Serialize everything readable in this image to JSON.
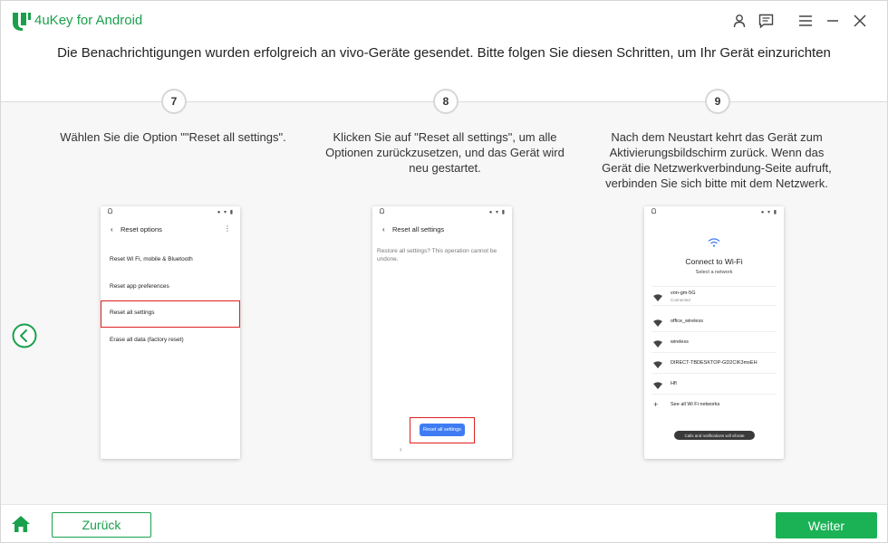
{
  "app": {
    "title": "4uKey for Android"
  },
  "heading": "Die Benachrichtigungen wurden erfolgreich an vivo-Geräte gesendet. Bitte folgen Sie diesen Schritten, um Ihr Gerät einzurichten",
  "steps": [
    {
      "number": "7",
      "description": "Wählen Sie die Option \"\"Reset all settings\".",
      "phone": {
        "title": "Reset options",
        "items": [
          "Reset Wi Fi, mobile & Bluetooth",
          "Reset app preferences",
          "Reset all settings",
          "Erase all data (factory reset)"
        ]
      }
    },
    {
      "number": "8",
      "description": "Klicken Sie auf \"Reset all settings\", um alle Optionen zurückzusetzen, und das Gerät wird neu gestartet.",
      "phone": {
        "title": "Reset all settings",
        "message": "Restore all settings? This operation cannot be undone.",
        "button": "Reset all settings"
      }
    },
    {
      "number": "9",
      "description": "Nach dem Neustart kehrt das Gerät zum Aktivierungsbildschirm zurück. Wenn das Gerät die Netzwerkverbindung-Seite aufruft, verbinden Sie sich bitte mit dem Netzwerk.",
      "phone": {
        "title": "Connect to Wi-Fi",
        "subtitle": "Select a network",
        "networks": [
          {
            "name": "von-gm-5G",
            "status": "Connected"
          },
          {
            "name": "office_wireless",
            "status": ""
          },
          {
            "name": "wireless",
            "status": ""
          },
          {
            "name": "DIRECT-TBDESKTOP-GD2CIK3msEH",
            "status": ""
          },
          {
            "name": "Hfl",
            "status": ""
          }
        ],
        "see_all": "See all Wi Fi networks",
        "toast": "Calls and notifications will vibrate"
      }
    }
  ],
  "footer": {
    "back_label": "Zurück",
    "next_label": "Weiter"
  },
  "colors": {
    "accent": "#1aa04b",
    "next_button": "#1bb256",
    "highlight": "#e02020",
    "phone_button": "#3f7cf4"
  }
}
